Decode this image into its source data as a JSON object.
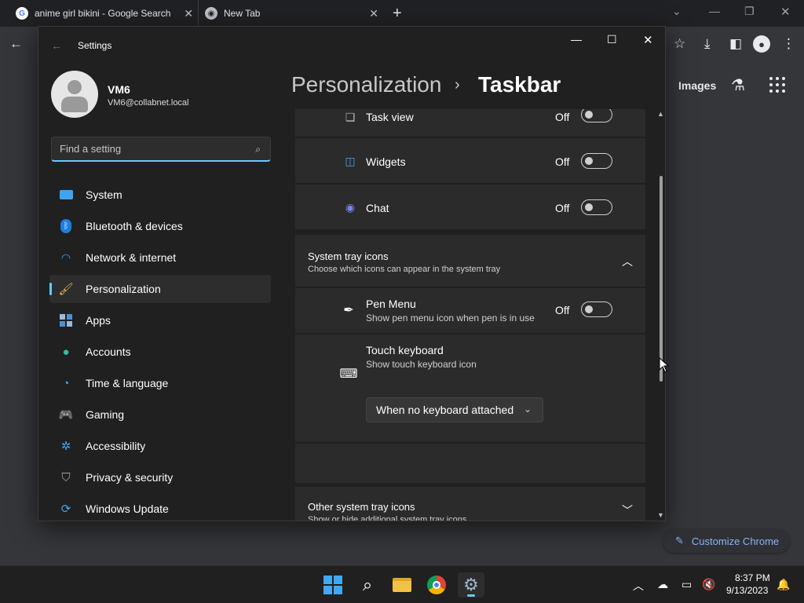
{
  "browser": {
    "tabs": [
      {
        "title": "anime girl bikini - Google Search"
      },
      {
        "title": "New Tab"
      }
    ],
    "new_tab_glyph": "+",
    "page": {
      "images_link": "Images",
      "customize_label": "Customize Chrome"
    }
  },
  "settings": {
    "window_title": "Settings",
    "user": {
      "name": "VM6",
      "email": "VM6@collabnet.local"
    },
    "search_placeholder": "Find a setting",
    "nav": [
      {
        "label": "System",
        "icon": "monitor-icon"
      },
      {
        "label": "Bluetooth & devices",
        "icon": "bluetooth-icon"
      },
      {
        "label": "Network & internet",
        "icon": "wifi-icon"
      },
      {
        "label": "Personalization",
        "icon": "brush-icon",
        "active": true
      },
      {
        "label": "Apps",
        "icon": "apps-icon"
      },
      {
        "label": "Accounts",
        "icon": "person-icon"
      },
      {
        "label": "Time & language",
        "icon": "globe-clock-icon"
      },
      {
        "label": "Gaming",
        "icon": "gamepad-icon"
      },
      {
        "label": "Accessibility",
        "icon": "accessibility-icon"
      },
      {
        "label": "Privacy & security",
        "icon": "shield-icon"
      },
      {
        "label": "Windows Update",
        "icon": "update-icon"
      }
    ],
    "breadcrumb": {
      "parent": "Personalization",
      "separator": "›",
      "current": "Taskbar"
    },
    "taskbar_items": [
      {
        "label": "Task view",
        "state": "Off"
      },
      {
        "label": "Widgets",
        "state": "Off"
      },
      {
        "label": "Chat",
        "state": "Off"
      }
    ],
    "system_tray": {
      "title": "System tray icons",
      "subtitle": "Choose which icons can appear in the system tray",
      "pen_menu": {
        "label": "Pen Menu",
        "subtitle": "Show pen menu icon when pen is in use",
        "state": "Off"
      },
      "touch_keyboard": {
        "label": "Touch keyboard",
        "subtitle": "Show touch keyboard icon",
        "dropdown_value": "When no keyboard attached"
      }
    },
    "other_tray": {
      "title": "Other system tray icons",
      "subtitle": "Show or hide additional system tray icons"
    }
  },
  "taskbar": {
    "time": "8:37 PM",
    "date": "9/13/2023"
  },
  "colors": {
    "accent": "#60cdff",
    "chrome_link": "#8ab4f8"
  }
}
